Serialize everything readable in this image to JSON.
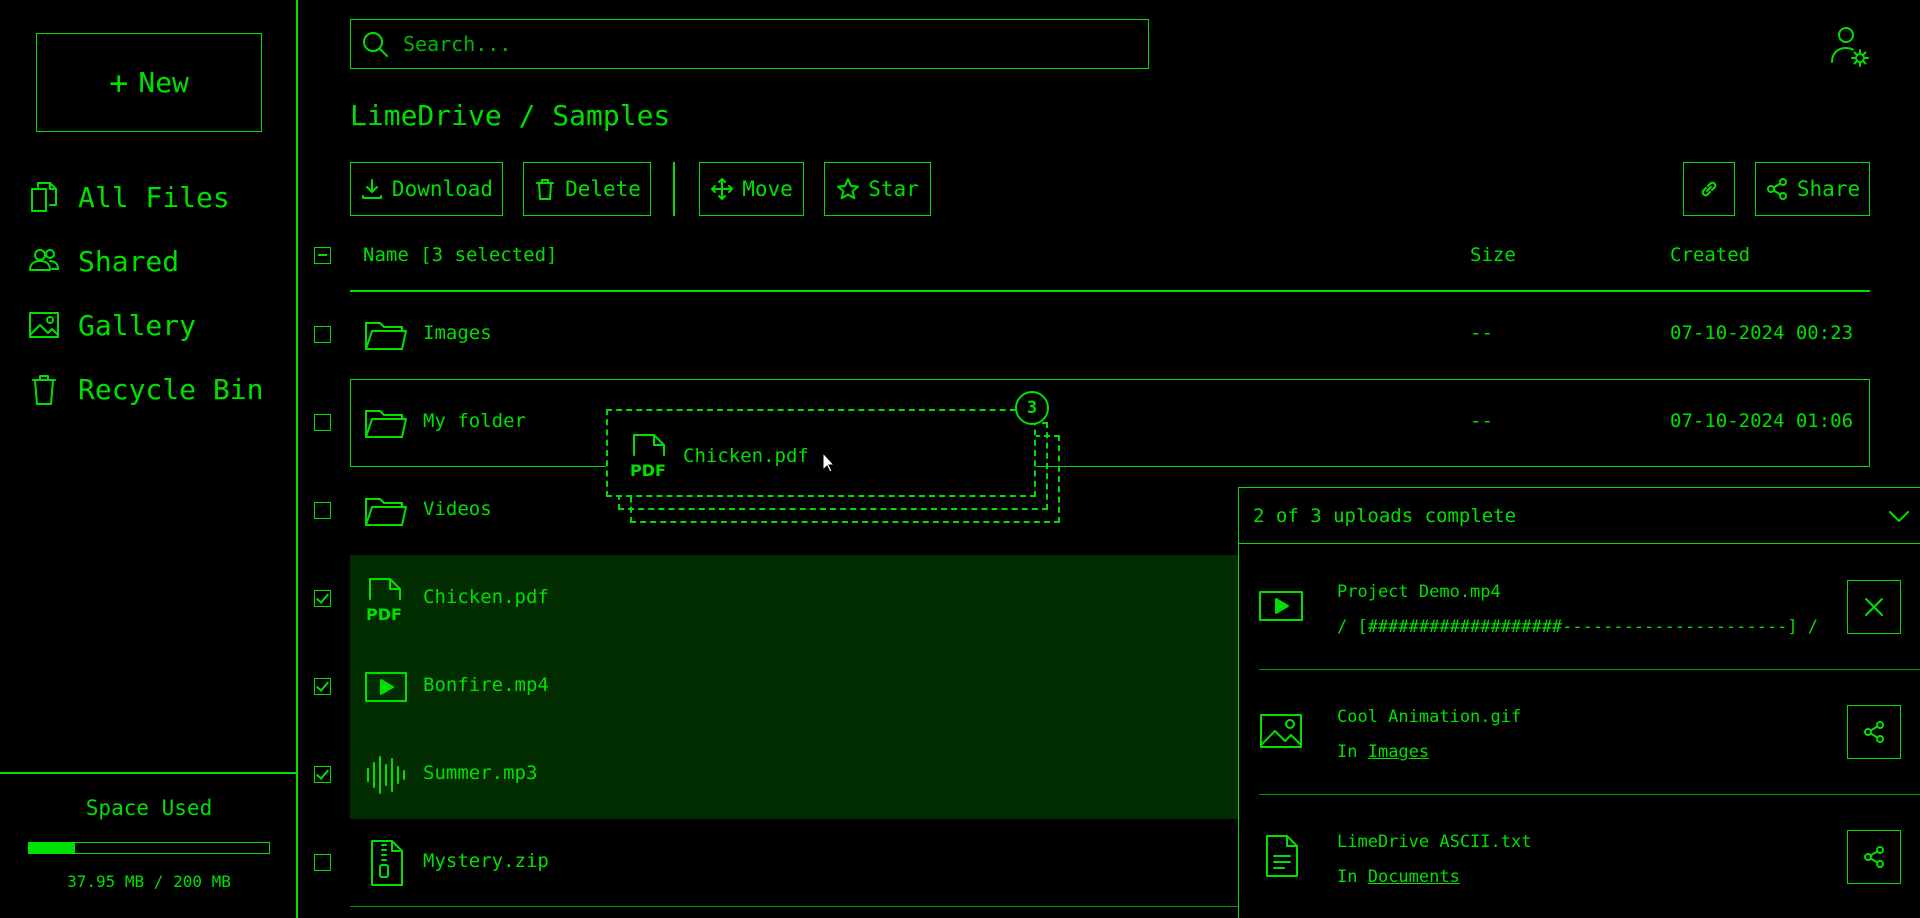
{
  "sidebar": {
    "new_label": "New",
    "items": [
      {
        "label": "All Files",
        "icon": "files-icon"
      },
      {
        "label": "Shared",
        "icon": "users-icon"
      },
      {
        "label": "Gallery",
        "icon": "image-icon"
      },
      {
        "label": "Recycle Bin",
        "icon": "trash-icon"
      }
    ],
    "space": {
      "title": "Space Used",
      "text": "37.95 MB / 200 MB",
      "used_fraction": 0.19
    }
  },
  "search": {
    "placeholder": "Search..."
  },
  "breadcrumb": "LimeDrive / Samples",
  "toolbar": {
    "download": "Download",
    "delete": "Delete",
    "move": "Move",
    "star": "Star",
    "share": "Share"
  },
  "table": {
    "headers": {
      "name": "Name [3 selected]",
      "size": "Size",
      "created": "Created"
    },
    "rows": [
      {
        "name": "Images",
        "type": "folder",
        "size": "--",
        "created": "07-10-2024 00:23",
        "selected": false
      },
      {
        "name": "My folder",
        "type": "folder",
        "size": "--",
        "created": "07-10-2024 01:06",
        "selected": false
      },
      {
        "name": "Videos",
        "type": "folder",
        "size": "",
        "created": "",
        "selected": false
      },
      {
        "name": "Chicken.pdf",
        "type": "pdf",
        "size": "",
        "created": "",
        "selected": true
      },
      {
        "name": "Bonfire.mp4",
        "type": "video",
        "size": "",
        "created": "",
        "selected": true
      },
      {
        "name": "Summer.mp3",
        "type": "audio",
        "size": "",
        "created": "",
        "selected": true
      },
      {
        "name": "Mystery.zip",
        "type": "zip",
        "size": "",
        "created": "",
        "selected": false
      }
    ]
  },
  "drag": {
    "name": "Chicken.pdf",
    "count": "3",
    "icon_label": "PDF"
  },
  "uploads": {
    "title": "2 of 3 uploads complete",
    "items": [
      {
        "name": "Project Demo.mp4",
        "sub": "/ [###################----------------------] /",
        "action": "close-icon"
      },
      {
        "name": "Cool Animation.gif",
        "sub_prefix": "In ",
        "sub_link": "Images",
        "action": "share-icon"
      },
      {
        "name": "LimeDrive ASCII.txt",
        "sub_prefix": "In ",
        "sub_link": "Documents",
        "action": "share-icon"
      }
    ]
  },
  "colors": {
    "accent": "#00e000",
    "background": "#000000",
    "selected_row": "#002c00"
  }
}
